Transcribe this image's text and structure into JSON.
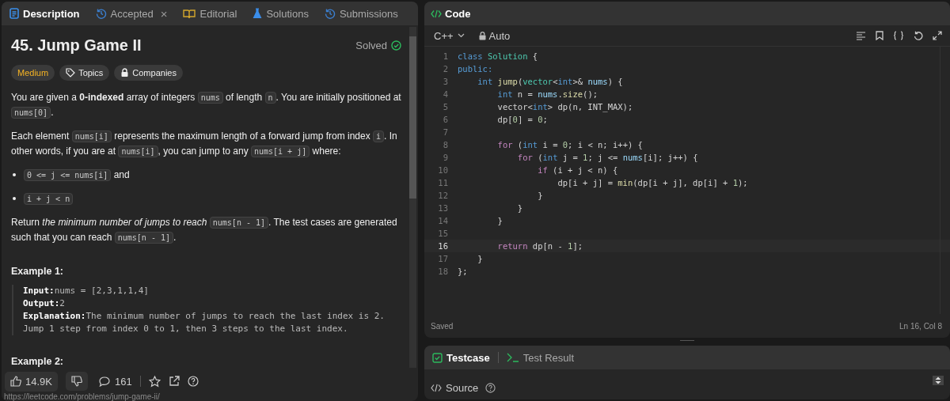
{
  "left_panel": {
    "tabs": [
      {
        "label": "Description",
        "kind": "doc",
        "selected": true
      },
      {
        "label": "Accepted",
        "kind": "history",
        "selected": false,
        "close_glyph": "×"
      },
      {
        "label": "Editorial",
        "kind": "book",
        "selected": false
      },
      {
        "label": "Solutions",
        "kind": "flask",
        "selected": false
      },
      {
        "label": "Submissions",
        "kind": "history",
        "selected": false
      }
    ],
    "problem": {
      "title": "45. Jump Game II",
      "status": "Solved",
      "tags": [
        {
          "label": "Medium",
          "kind": "difficulty"
        },
        {
          "label": "Topics",
          "kind": "topics"
        },
        {
          "label": "Companies",
          "kind": "companies"
        }
      ],
      "blocks": [
        {
          "kind": "paragraph",
          "segs": [
            {
              "kind": "text",
              "text": "You are given a "
            },
            {
              "kind": "bold",
              "text": "0-indexed"
            },
            {
              "kind": "text",
              "text": " array of integers "
            },
            {
              "kind": "code",
              "text": "nums"
            },
            {
              "kind": "text",
              "text": " of length "
            },
            {
              "kind": "code",
              "text": "n"
            },
            {
              "kind": "text",
              "text": ". You are initially positioned at "
            },
            {
              "kind": "code",
              "text": "nums[0]"
            },
            {
              "kind": "text",
              "text": "."
            }
          ]
        },
        {
          "kind": "paragraph",
          "segs": [
            {
              "kind": "text",
              "text": "Each element "
            },
            {
              "kind": "code",
              "text": "nums[i]"
            },
            {
              "kind": "text",
              "text": " represents the maximum length of a forward jump from index "
            },
            {
              "kind": "code",
              "text": "i"
            },
            {
              "kind": "text",
              "text": ". In other words, if you are at "
            },
            {
              "kind": "code",
              "text": "nums[i]"
            },
            {
              "kind": "text",
              "text": ", you can jump to any "
            },
            {
              "kind": "code",
              "text": "nums[i + j]"
            },
            {
              "kind": "text",
              "text": " where:"
            }
          ]
        },
        {
          "kind": "bullet",
          "segs": [
            {
              "kind": "code",
              "text": "0 <= j <= nums[i]"
            },
            {
              "kind": "text",
              "text": " and"
            }
          ]
        },
        {
          "kind": "bullet",
          "segs": [
            {
              "kind": "code",
              "text": "i + j < n"
            }
          ]
        },
        {
          "kind": "paragraph",
          "segs": [
            {
              "kind": "text",
              "text": "Return "
            },
            {
              "kind": "italic",
              "text": "the minimum number of jumps to reach "
            },
            {
              "kind": "code",
              "text": "nums[n - 1]"
            },
            {
              "kind": "text",
              "text": ". The test cases are generated such that you can reach "
            },
            {
              "kind": "code",
              "text": "nums[n - 1]"
            },
            {
              "kind": "text",
              "text": "."
            }
          ]
        }
      ],
      "examples": [
        {
          "heading": "Example 1:",
          "lines": [
            {
              "label": "Input:",
              "value": "nums = [2,3,1,1,4]"
            },
            {
              "label": "Output:",
              "value": "2"
            },
            {
              "label": "Explanation:",
              "value": "The minimum number of jumps to reach the last index is 2."
            },
            {
              "value": "Jump 1 step from index 0 to 1, then 3 steps to the last index."
            }
          ]
        },
        {
          "heading": "Example 2:"
        }
      ]
    },
    "footer": {
      "likes": "14.9K",
      "comments": "161"
    },
    "link_preview": "https://leetcode.com/problems/jump-game-ii/"
  },
  "code_panel": {
    "title": "Code",
    "language": "C++",
    "mode": "Auto",
    "lines": [
      {
        "number": "1",
        "selected": false,
        "segs": [
          {
            "kind": "k",
            "text": "class "
          },
          {
            "kind": "t",
            "text": "Solution"
          },
          {
            "kind": "p",
            "text": " {"
          }
        ]
      },
      {
        "number": "2",
        "selected": false,
        "segs": [
          {
            "kind": "k",
            "text": "public:"
          }
        ]
      },
      {
        "number": "3",
        "selected": false,
        "segs": [
          {
            "kind": "k",
            "text": "    int "
          },
          {
            "kind": "f",
            "text": "jump"
          },
          {
            "kind": "p",
            "text": "("
          },
          {
            "kind": "t",
            "text": "vector"
          },
          {
            "kind": "p",
            "text": "<"
          },
          {
            "kind": "k",
            "text": "int"
          },
          {
            "kind": "p",
            "text": ">& "
          },
          {
            "kind": "v",
            "text": "nums"
          },
          {
            "kind": "p",
            "text": ") {"
          }
        ]
      },
      {
        "number": "4",
        "selected": false,
        "segs": [
          {
            "kind": "k",
            "text": "        int"
          },
          {
            "kind": "p",
            "text": " n = "
          },
          {
            "kind": "v",
            "text": "nums"
          },
          {
            "kind": "p",
            "text": "."
          },
          {
            "kind": "f",
            "text": "size"
          },
          {
            "kind": "p",
            "text": "();"
          }
        ]
      },
      {
        "number": "5",
        "selected": false,
        "segs": [
          {
            "kind": "p",
            "text": "        vector<"
          },
          {
            "kind": "k",
            "text": "int"
          },
          {
            "kind": "p",
            "text": "> dp(n, INT_MAX);"
          }
        ]
      },
      {
        "number": "6",
        "selected": false,
        "segs": [
          {
            "kind": "p",
            "text": "        dp["
          },
          {
            "kind": "n",
            "text": "0"
          },
          {
            "kind": "p",
            "text": "] = "
          },
          {
            "kind": "n",
            "text": "0"
          },
          {
            "kind": "p",
            "text": ";"
          }
        ]
      },
      {
        "number": "7",
        "selected": false
      },
      {
        "number": "8",
        "selected": false,
        "segs": [
          {
            "kind": "c",
            "text": "        for"
          },
          {
            "kind": "p",
            "text": " ("
          },
          {
            "kind": "k",
            "text": "int"
          },
          {
            "kind": "p",
            "text": " i = "
          },
          {
            "kind": "n",
            "text": "0"
          },
          {
            "kind": "p",
            "text": "; i < n; i++) {"
          }
        ]
      },
      {
        "number": "9",
        "selected": false,
        "segs": [
          {
            "kind": "c",
            "text": "            for"
          },
          {
            "kind": "p",
            "text": " ("
          },
          {
            "kind": "k",
            "text": "int"
          },
          {
            "kind": "p",
            "text": " j = "
          },
          {
            "kind": "n",
            "text": "1"
          },
          {
            "kind": "p",
            "text": "; j <= "
          },
          {
            "kind": "v",
            "text": "nums"
          },
          {
            "kind": "p",
            "text": "[i]; j++) {"
          }
        ]
      },
      {
        "number": "10",
        "selected": false,
        "segs": [
          {
            "kind": "c",
            "text": "                if"
          },
          {
            "kind": "p",
            "text": " (i + j < n) {"
          }
        ]
      },
      {
        "number": "11",
        "selected": false,
        "segs": [
          {
            "kind": "p",
            "text": "                    dp[i + j] = "
          },
          {
            "kind": "f",
            "text": "min"
          },
          {
            "kind": "p",
            "text": "(dp[i + j], dp[i] + "
          },
          {
            "kind": "n",
            "text": "1"
          },
          {
            "kind": "p",
            "text": ");"
          }
        ]
      },
      {
        "number": "12",
        "selected": false,
        "segs": [
          {
            "kind": "p",
            "text": "                }"
          }
        ]
      },
      {
        "number": "13",
        "selected": false,
        "segs": [
          {
            "kind": "p",
            "text": "            }"
          }
        ]
      },
      {
        "number": "14",
        "selected": false,
        "segs": [
          {
            "kind": "p",
            "text": "        }"
          }
        ]
      },
      {
        "number": "15",
        "selected": false
      },
      {
        "number": "16",
        "selected": true,
        "segs": [
          {
            "kind": "c",
            "text": "        return"
          },
          {
            "kind": "p",
            "text": " dp[n - "
          },
          {
            "kind": "n",
            "text": "1"
          },
          {
            "kind": "p",
            "text": "];"
          }
        ]
      },
      {
        "number": "17",
        "selected": false,
        "segs": [
          {
            "kind": "p",
            "text": "    }"
          }
        ]
      },
      {
        "number": "18",
        "selected": false,
        "segs": [
          {
            "kind": "p",
            "text": "};"
          }
        ]
      }
    ],
    "status": "Saved",
    "cursor": "Ln 16, Col 8"
  },
  "test_panel": {
    "tabs": [
      {
        "label": "Testcase",
        "kind": "testcase",
        "selected": true
      },
      {
        "label": "Test Result",
        "kind": "terminal",
        "selected": false
      }
    ],
    "source_label": "Source"
  }
}
